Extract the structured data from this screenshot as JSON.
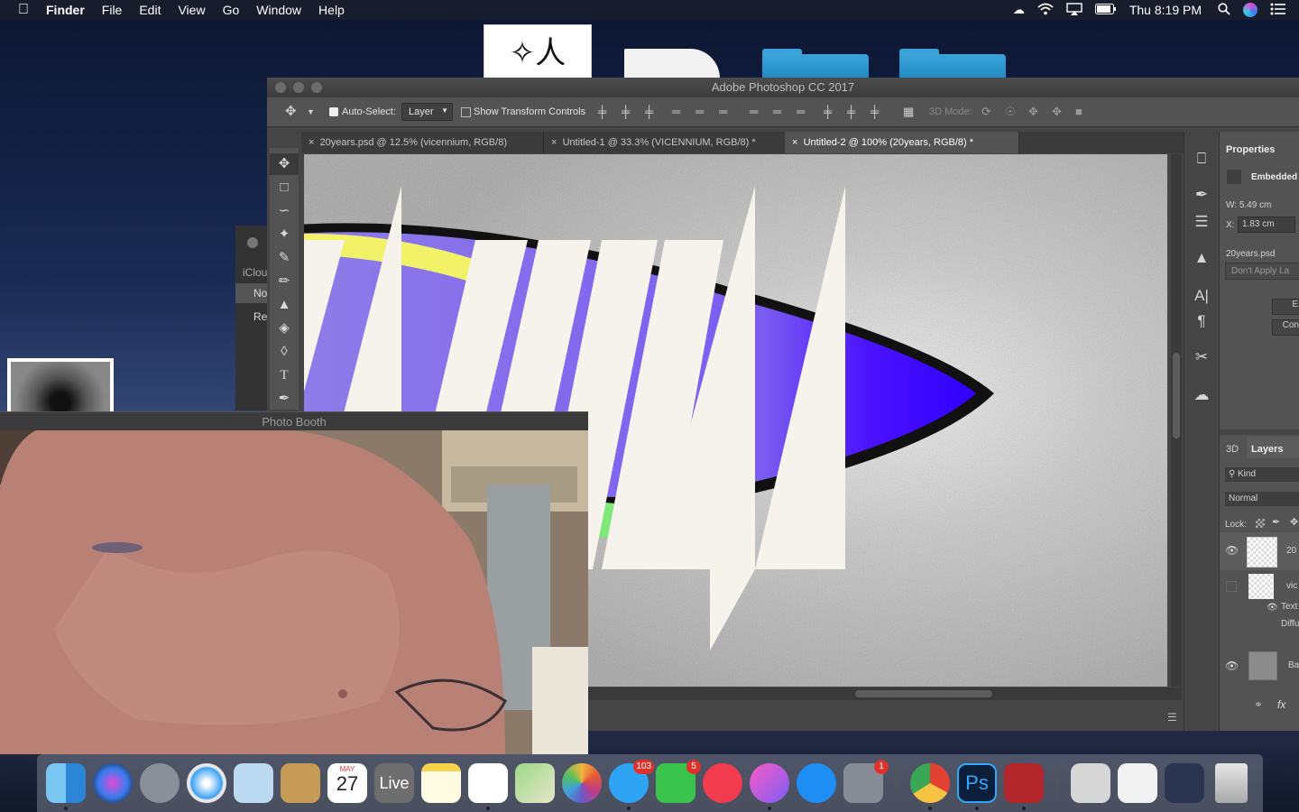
{
  "menubar": {
    "app_name": "Finder",
    "items": [
      "File",
      "Edit",
      "View",
      "Go",
      "Window",
      "Help"
    ],
    "clock": "Thu 8:19 PM"
  },
  "photoshop": {
    "window_title": "Adobe Photoshop CC 2017",
    "options": {
      "auto_select_label": "Auto-Select:",
      "auto_select_value": "Layer",
      "show_transform_label": "Show Transform Controls",
      "mode_3d_label": "3D Mode:"
    },
    "tabs": [
      {
        "label": "20years.psd @ 12.5% (vicennium, RGB/8)"
      },
      {
        "label": "Untitled-1 @ 33.3% (VICENNIUM, RGB/8) *"
      },
      {
        "label": "Untitled-2 @ 100% (20years, RGB/8) *"
      }
    ],
    "properties": {
      "title": "Properties",
      "type_label": "Embedded",
      "width": "W: 5.49 cm",
      "x_label": "X:",
      "x_value": "1.83 cm",
      "file_name": "20years.psd",
      "dont_apply": "Don't Apply La",
      "btn_e": "E",
      "btn_conv": "Con"
    },
    "layers_panel": {
      "tab_3d": "3D",
      "tab_layers": "Layers",
      "kind_label": "Kind",
      "blend_mode": "Normal",
      "lock_label": "Lock:",
      "layer1": "20",
      "layer2": "vic",
      "fx_label1": "Text",
      "fx_label2": "Diffu",
      "layer3": "Ba",
      "fx_icon": "fx"
    }
  },
  "finder_window": {
    "sidebar_header": "iClou",
    "item1": "No",
    "item2": "Re"
  },
  "photo_booth": {
    "title": "Photo Booth"
  },
  "desktop_icon_text": "✧人",
  "dock": {
    "calendar_month": "MAY",
    "calendar_day": "27",
    "live_label": "Live",
    "messages_badge": "103",
    "facetime_badge": "5",
    "settings_badge": "1",
    "ps_label": "Ps"
  }
}
